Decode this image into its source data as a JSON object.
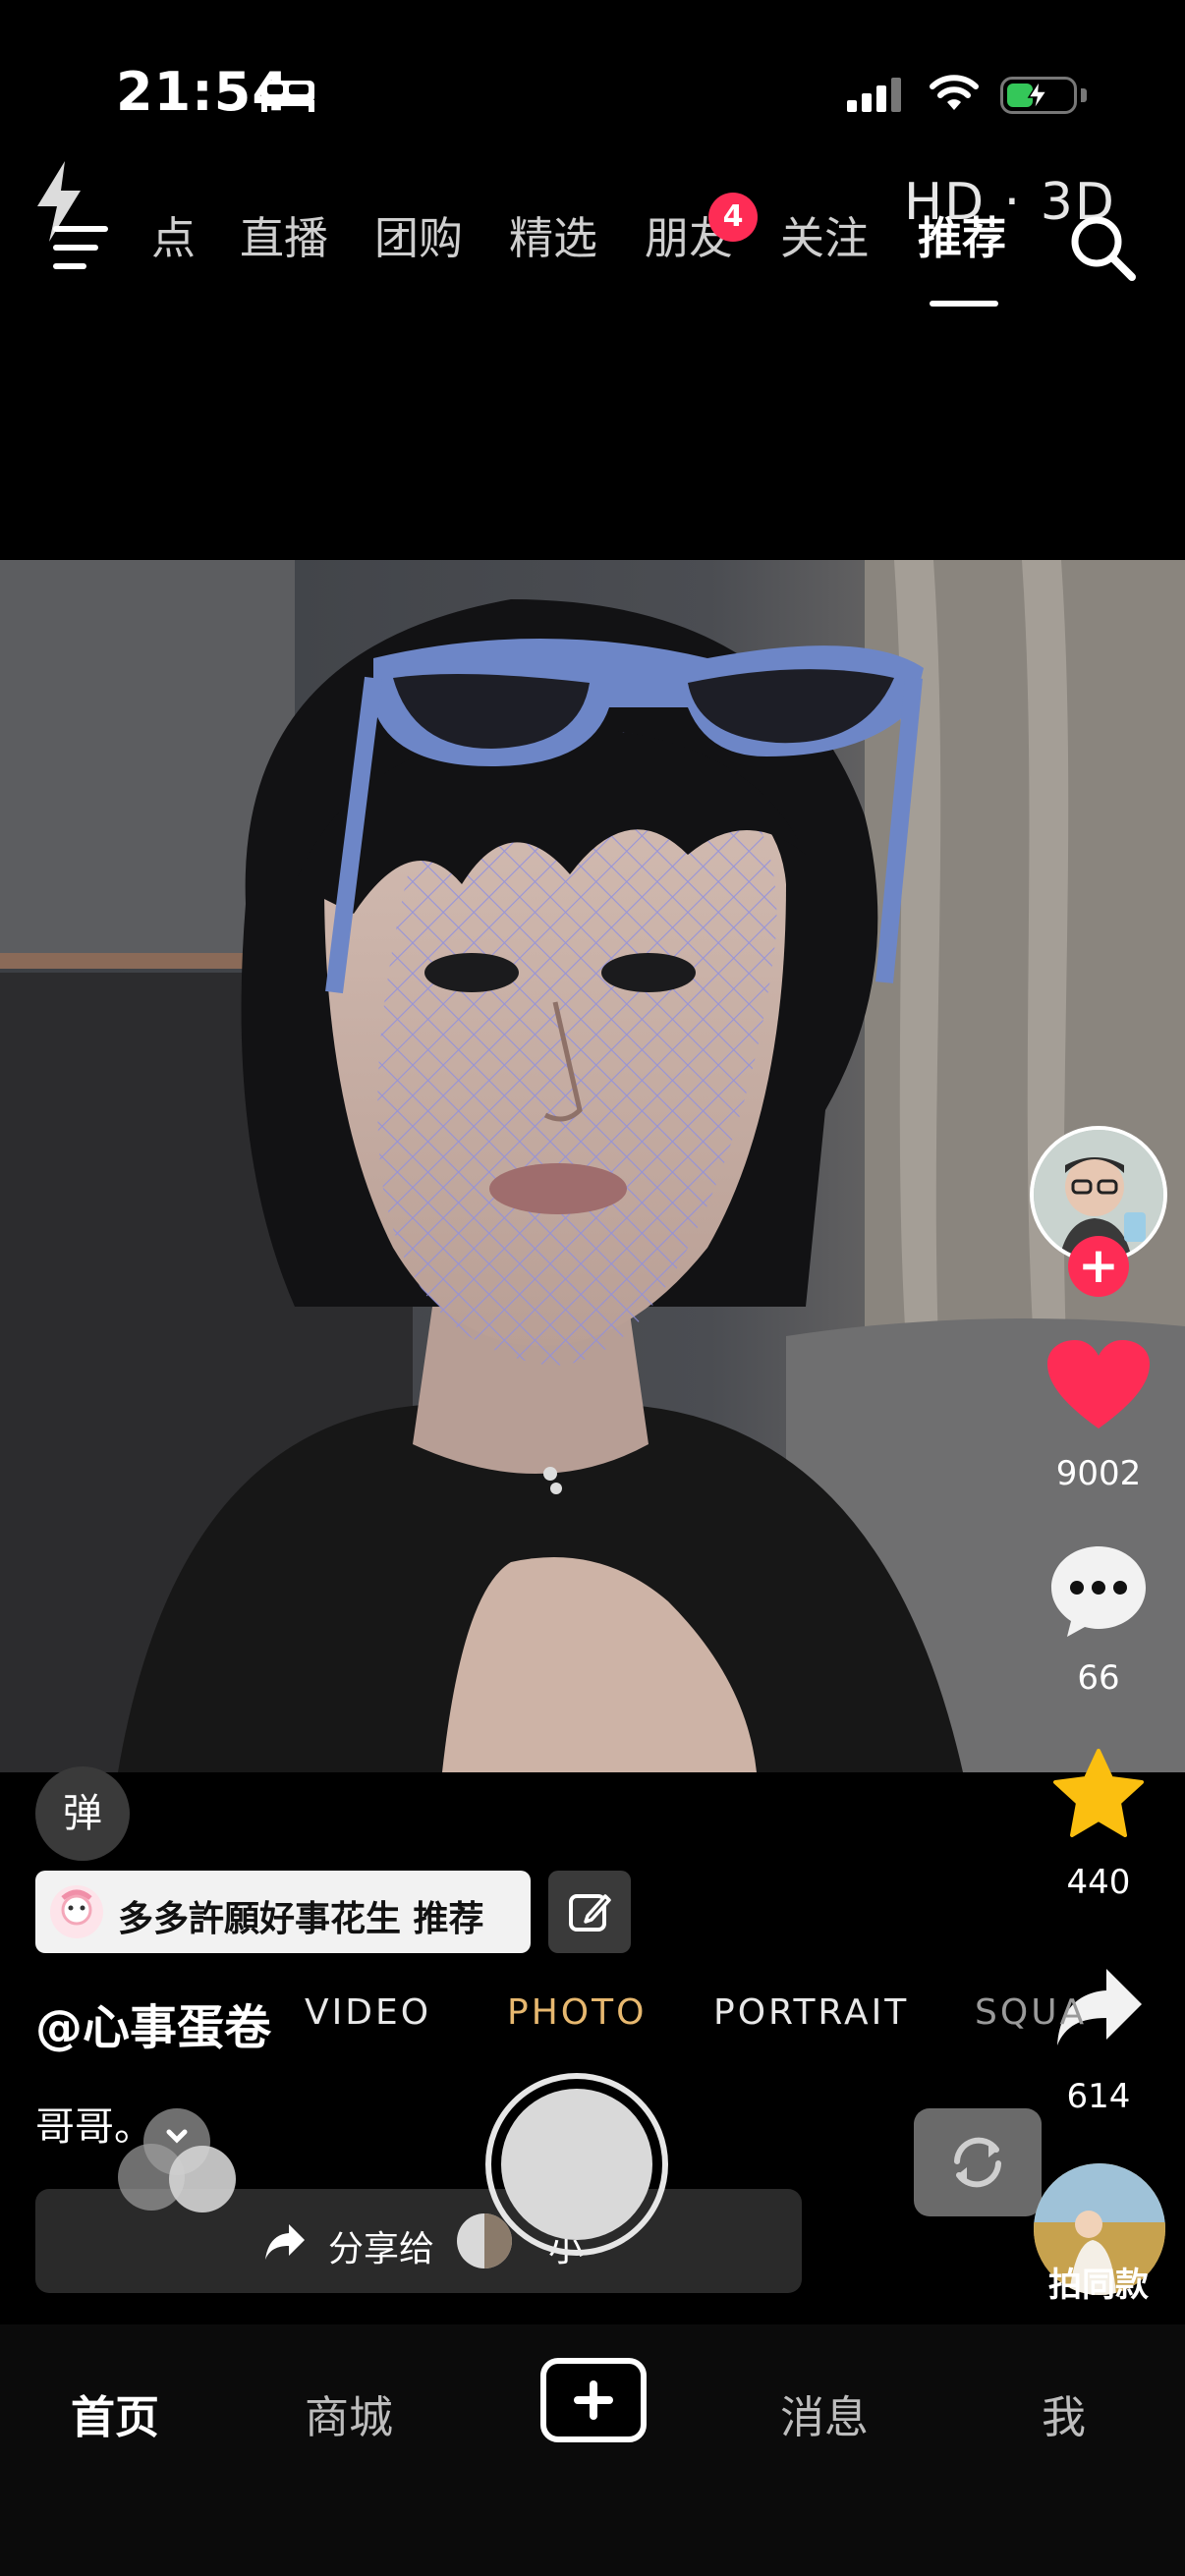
{
  "status_bar": {
    "time": "21:54"
  },
  "top_nav": {
    "tabs": [
      {
        "label": "点"
      },
      {
        "label": "直播"
      },
      {
        "label": "团购"
      },
      {
        "label": "精选"
      },
      {
        "label": "朋友",
        "badge": "4"
      },
      {
        "label": "关注"
      },
      {
        "label": "推荐",
        "active": true
      }
    ],
    "overlay_label": "HD · 3D"
  },
  "camera_modes": [
    "VIDEO",
    "PHOTO",
    "PORTRAIT",
    "SQUA"
  ],
  "camera_active_mode": "PHOTO",
  "sidebar": {
    "likes": "9002",
    "comments": "66",
    "favorites": "440",
    "shares": "614",
    "same_style_label": "拍同款"
  },
  "post": {
    "danmu_label": "弹",
    "recommend_tag": "多多許願好事花生  推荐",
    "author": "@心事蛋卷",
    "caption": "哥哥。",
    "share_label": "分享给",
    "share_target": "小"
  },
  "bottom_nav": {
    "home": "首页",
    "mall": "商城",
    "messages": "消息",
    "me": "我"
  },
  "colors": {
    "accent": "#fe2c55",
    "like": "#fe2c55",
    "favorite": "#fbbf10",
    "photo_mode": "#e7b86f"
  }
}
